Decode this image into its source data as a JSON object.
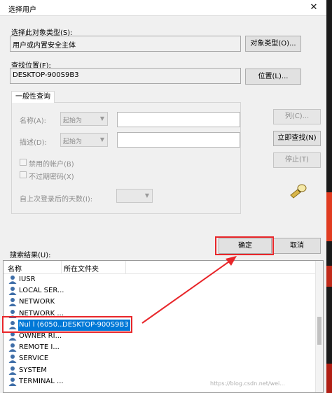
{
  "window": {
    "title": "选择用户",
    "close_glyph": "✕"
  },
  "object_type": {
    "label": "选择此对象类型(S):",
    "value": "用户或内置安全主体",
    "button": "对象类型(O)..."
  },
  "location": {
    "label": "查找位置(F):",
    "value": "DESKTOP-900S9B3",
    "button": "位置(L)..."
  },
  "general_query": {
    "tab": "一般性查询",
    "name_label": "名称(A):",
    "desc_label": "描述(D):",
    "starts_with": "起始为",
    "disabled_accounts": "禁用的帐户(B)",
    "non_expiring": "不过期密码(X)",
    "days_since_logon": "自上次登录后的天数(I):"
  },
  "side_buttons": {
    "columns": "列(C)...",
    "find_now": "立即查找(N)",
    "stop": "停止(T)"
  },
  "actions": {
    "ok": "确定",
    "cancel": "取消"
  },
  "results": {
    "label": "搜索结果(U):",
    "columns": [
      "名称",
      "所在文件夹"
    ],
    "rows": [
      {
        "name": "IUSR",
        "folder": ""
      },
      {
        "name": "LOCAL SER...",
        "folder": ""
      },
      {
        "name": "NETWORK",
        "folder": ""
      },
      {
        "name": "NETWORK ...",
        "folder": ""
      },
      {
        "name": "Nul l (6050...",
        "folder": "DESKTOP-900S9B3",
        "selected": true
      },
      {
        "name": "OWNER RI...",
        "folder": ""
      },
      {
        "name": "REMOTE I...",
        "folder": ""
      },
      {
        "name": "SERVICE",
        "folder": ""
      },
      {
        "name": "SYSTEM",
        "folder": ""
      },
      {
        "name": "TERMINAL ...",
        "folder": ""
      }
    ]
  },
  "watermark": "https://blog.csdn.net/wei..."
}
